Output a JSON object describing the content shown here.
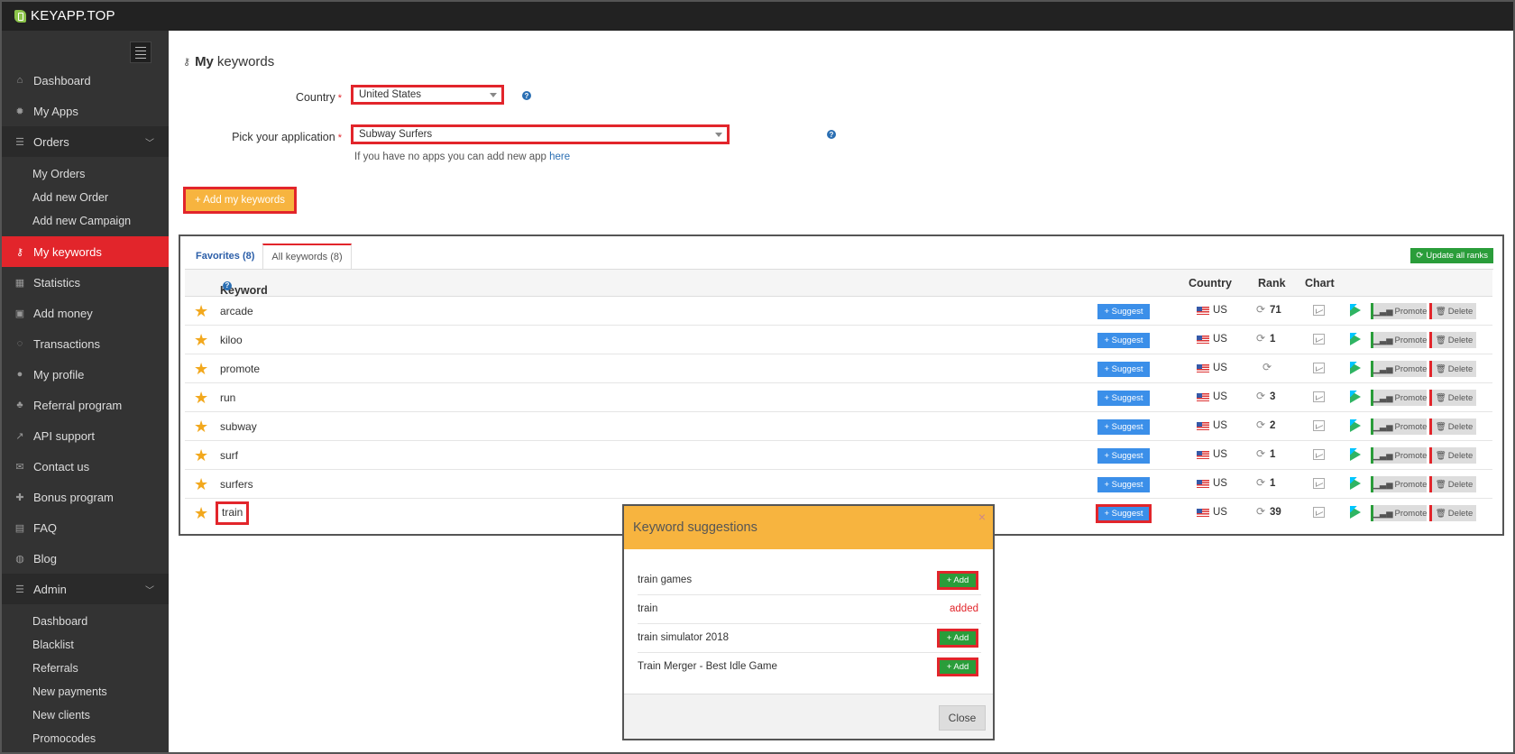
{
  "brand": {
    "name": "KEYAPP.TOP"
  },
  "sidebar": {
    "items": [
      {
        "label": "Dashboard",
        "icon": "home-icon"
      },
      {
        "label": "My Apps",
        "icon": "gear-icon"
      },
      {
        "label": "Orders",
        "icon": "list-icon"
      },
      {
        "label": "My keywords",
        "icon": "key-icon"
      },
      {
        "label": "Statistics",
        "icon": "table-icon"
      },
      {
        "label": "Add money",
        "icon": "money-icon"
      },
      {
        "label": "Transactions",
        "icon": "spinner-icon"
      },
      {
        "label": "My profile",
        "icon": "user-icon"
      },
      {
        "label": "Referral program",
        "icon": "sitemap-icon"
      },
      {
        "label": "API support",
        "icon": "external-link-icon"
      },
      {
        "label": "Contact us",
        "icon": "envelope-icon"
      },
      {
        "label": "Bonus program",
        "icon": "gift-icon"
      },
      {
        "label": "FAQ",
        "icon": "book-icon"
      },
      {
        "label": "Blog",
        "icon": "comments-icon"
      },
      {
        "label": "Admin",
        "icon": "list-icon"
      }
    ],
    "orders_sub": [
      "My Orders",
      "Add new Order",
      "Add new Campaign"
    ],
    "admin_sub": [
      "Dashboard",
      "Blacklist",
      "Referrals",
      "New payments",
      "New clients",
      "Promocodes"
    ]
  },
  "page": {
    "title_bold": "My",
    "title_rest": "keywords",
    "country_label": "Country",
    "country_value": "United States",
    "app_label": "Pick your application",
    "app_value": "Subway Surfers",
    "hint_text": "If you have no apps you can add new app",
    "hint_link": "here",
    "add_button": "+ Add my keywords",
    "required_mark": "*",
    "help_mark": "?"
  },
  "panel": {
    "tab_favorites": "Favorites (8)",
    "tab_all": "All keywords (8)",
    "update_button": "Update all ranks",
    "col_keyword": "Keyword",
    "col_country": "Country",
    "col_rank": "Rank",
    "col_chart": "Chart",
    "suggest_label": "+ Suggest",
    "promote_label": "Promote",
    "delete_label": "Delete",
    "rows": [
      {
        "keyword": "arcade",
        "country": "US",
        "rank": "71"
      },
      {
        "keyword": "kiloo",
        "country": "US",
        "rank": "1"
      },
      {
        "keyword": "promote",
        "country": "US",
        "rank": ""
      },
      {
        "keyword": "run",
        "country": "US",
        "rank": "3"
      },
      {
        "keyword": "subway",
        "country": "US",
        "rank": "2"
      },
      {
        "keyword": "surf",
        "country": "US",
        "rank": "1"
      },
      {
        "keyword": "surfers",
        "country": "US",
        "rank": "1"
      },
      {
        "keyword": "train",
        "country": "US",
        "rank": "39"
      }
    ]
  },
  "modal": {
    "title": "Keyword suggestions",
    "close_x": "×",
    "add_label": "+ Add",
    "suggestions": [
      {
        "text": "train games",
        "status": "add"
      },
      {
        "text": "train",
        "status": "added",
        "status_label": "added"
      },
      {
        "text": "train simulator 2018",
        "status": "add"
      },
      {
        "text": "Train Merger - Best Idle Game",
        "status": "add"
      }
    ],
    "close_button": "Close"
  },
  "colors": {
    "accent": "#e2252b",
    "sidebar_bg": "#333333",
    "topbar_bg": "#222222",
    "orange": "#f7b43f",
    "suggest_blue": "#3b8fe9",
    "green": "#2a9d3a"
  }
}
